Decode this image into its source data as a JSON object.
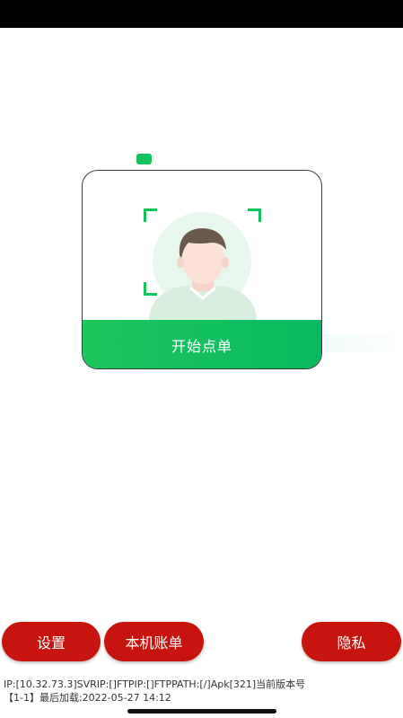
{
  "face_card": {
    "start_label": "开始点单"
  },
  "bottom_bar": {
    "settings_label": "设置",
    "bills_label": "本机账单",
    "privacy_label": "隐私"
  },
  "info": {
    "line1": "IP:[10.32.73.3]SVRIP:[]FTPIP:[]FTPPATH:[/]Apk[321]当前版本号",
    "line2": "【1-1】最后加载:2022-05-27 14:12"
  },
  "colors": {
    "accent_green": "#12c25a",
    "button_red": "#c8140e"
  }
}
